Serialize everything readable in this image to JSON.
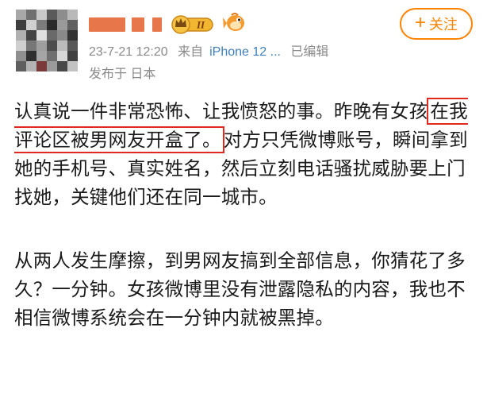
{
  "header": {
    "follow_label": "关注",
    "follow_plus": "+",
    "vip_badge_text": "II",
    "meta": {
      "date": "23-7-21 12:20",
      "source_prefix": "来自",
      "device": "iPhone 12 ...",
      "edited": "已编辑",
      "location": "发布于 日本"
    }
  },
  "post": {
    "p1_line1": "认真说一件非常恐怖、让我愤怒的事。昨晚有女",
    "p1_pre": "孩",
    "p1_highlight": "在我评论区被男网友开盒了。",
    "p1_post": "对方只凭微博账号，瞬间拿到她的手机号、真实姓名，然后立刻电话骚扰威胁要上门找她，关键他们还在同一城市。",
    "p2": "从两人发生摩擦，到男网友搞到全部信息，你猜花了多久？一分钟。女孩微博里没有泄露隐私的内容，我也不相信微博系统会在一分钟内就被黑掉。"
  },
  "colors": {
    "accent": "#ff8200",
    "link": "#3f7fbf",
    "meta": "#8a8a8a",
    "highlight_border": "#e3281f",
    "username_blur": "#e8764b"
  },
  "icons": {
    "vip": "crown-vip-badge-icon",
    "fish": "fish-badge-icon",
    "plus": "plus-icon"
  }
}
